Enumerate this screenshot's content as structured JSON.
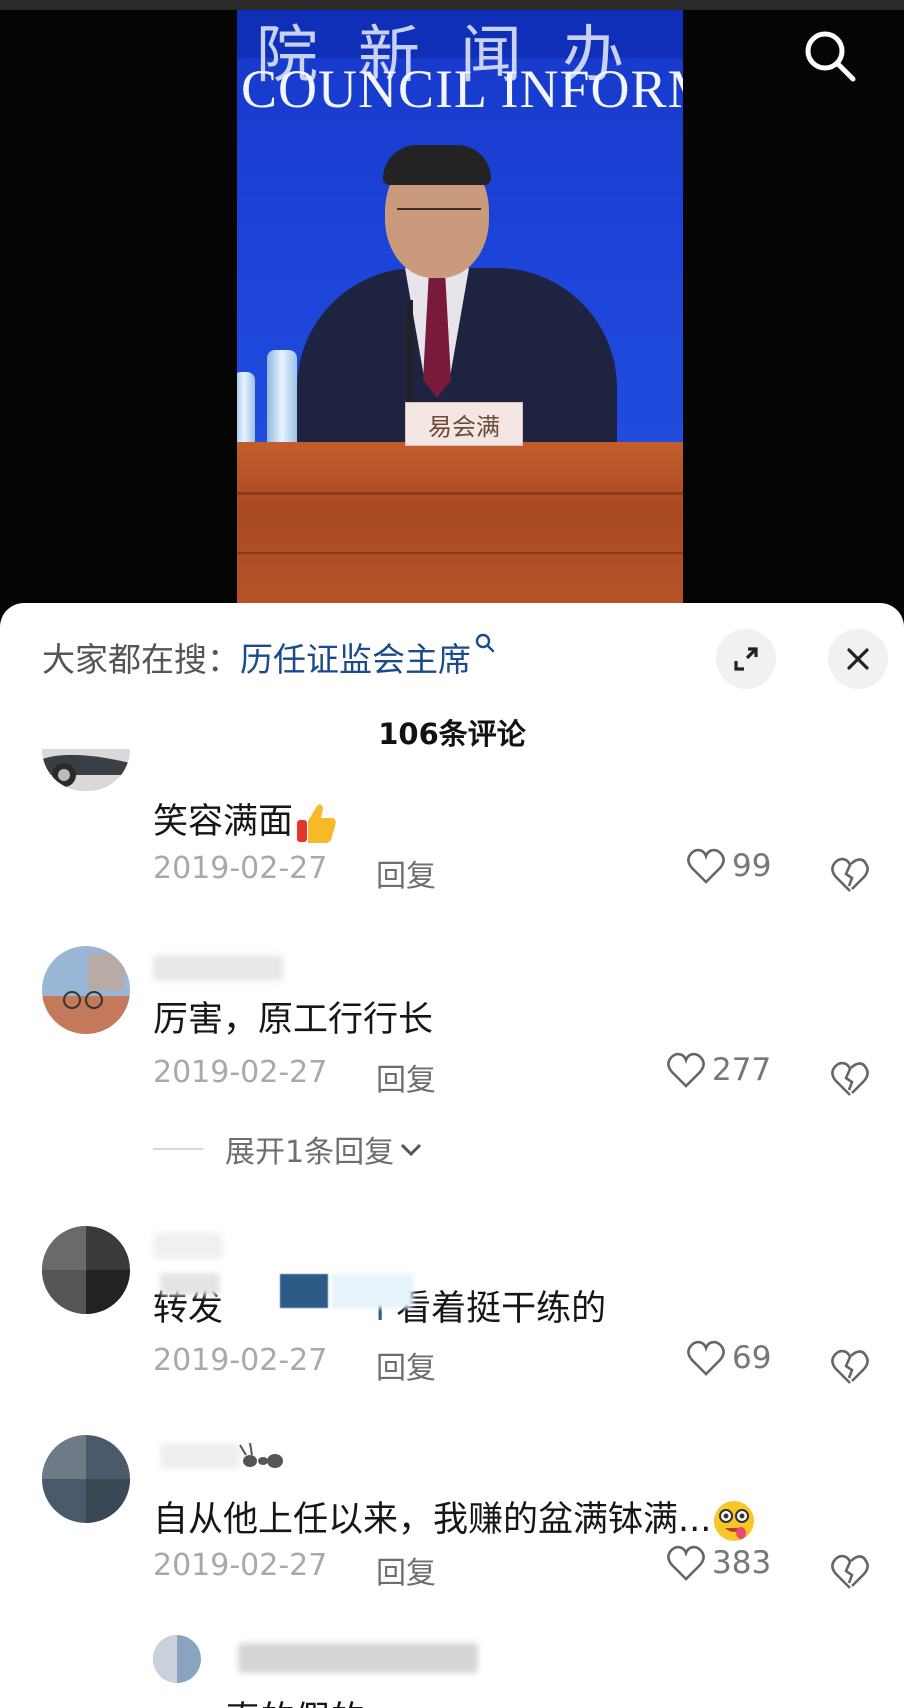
{
  "video": {
    "headline_text": "院新闻办",
    "banner_text": "COUNCIL INFORMAT",
    "nameplate": "易会满"
  },
  "sheet": {
    "hot_search_label": "大家都在搜：",
    "hot_search_keyword": "历任证监会主席",
    "comment_count_title": "106条评论"
  },
  "comments": [
    {
      "text": "笑容满面",
      "date": "2019-02-27",
      "reply": "回复",
      "likes": "99"
    },
    {
      "text": "厉害，原工行行长",
      "date": "2019-02-27",
      "reply": "回复",
      "likes": "277",
      "expand": "展开1条回复"
    },
    {
      "text_prefix": "转发",
      "text_suffix": "看着挺干练的",
      "date": "2019-02-27",
      "reply": "回复",
      "likes": "69"
    },
    {
      "text": "自从他上任以来，我赚的盆满钵满...",
      "date": "2019-02-27",
      "reply": "回复",
      "likes": "383"
    },
    {
      "text": "真的假的"
    }
  ],
  "colors": {
    "keyword": "#1a4b8a",
    "date": "#a9a9a9",
    "banner_blue": "#1c44d8"
  }
}
